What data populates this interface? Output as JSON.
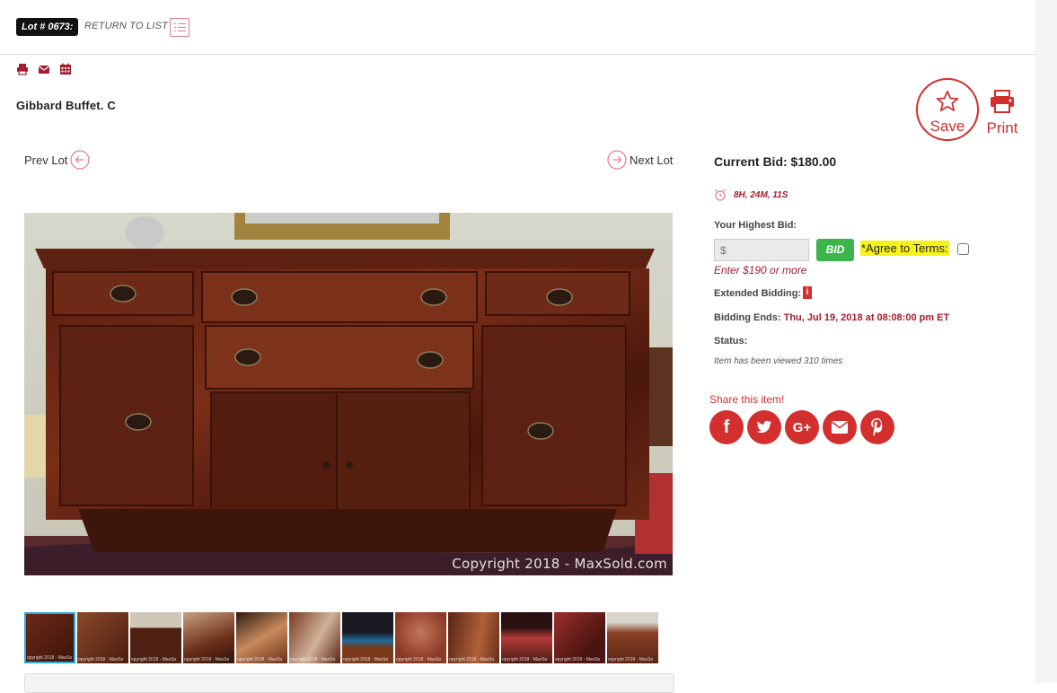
{
  "header": {
    "lot_badge": "Lot # 0673:",
    "return_label": "RETURN TO LIST"
  },
  "item": {
    "title": "Gibbard Buffet. C"
  },
  "actions": {
    "save_label": "Save",
    "print_label": "Print"
  },
  "nav": {
    "prev_label": "Prev Lot",
    "next_label": "Next Lot"
  },
  "gallery": {
    "watermark": "Copyright 2018 - MaxSold.com",
    "thumb_watermark": "opyright 2018 - MaxSo",
    "thumb_count": 12
  },
  "bidding": {
    "current_bid": "Current Bid: $180.00",
    "time_left": "8H, 24M, 11S",
    "highest_bid_label": "Your Highest Bid:",
    "input_placeholder": "$",
    "bid_button": "BID",
    "agree_label": "*Agree to Terms:",
    "enter_hint": "Enter $190 or more",
    "extended_label": "Extended Bidding:",
    "extended_icon_text": "i",
    "ends_label": "Bidding Ends:",
    "ends_value": "Thu, Jul 19, 2018 at 08:08:00 pm ET",
    "status_label": "Status:",
    "viewed_text": "Item has been viewed 310 times"
  },
  "share": {
    "title": "Share this item!",
    "facebook": "f",
    "googleplus": "G+"
  },
  "colors": {
    "accent": "#d32f2f",
    "dark_red": "#a41c2f",
    "bid_green": "#3cb54a",
    "highlight": "#f6f21a"
  }
}
